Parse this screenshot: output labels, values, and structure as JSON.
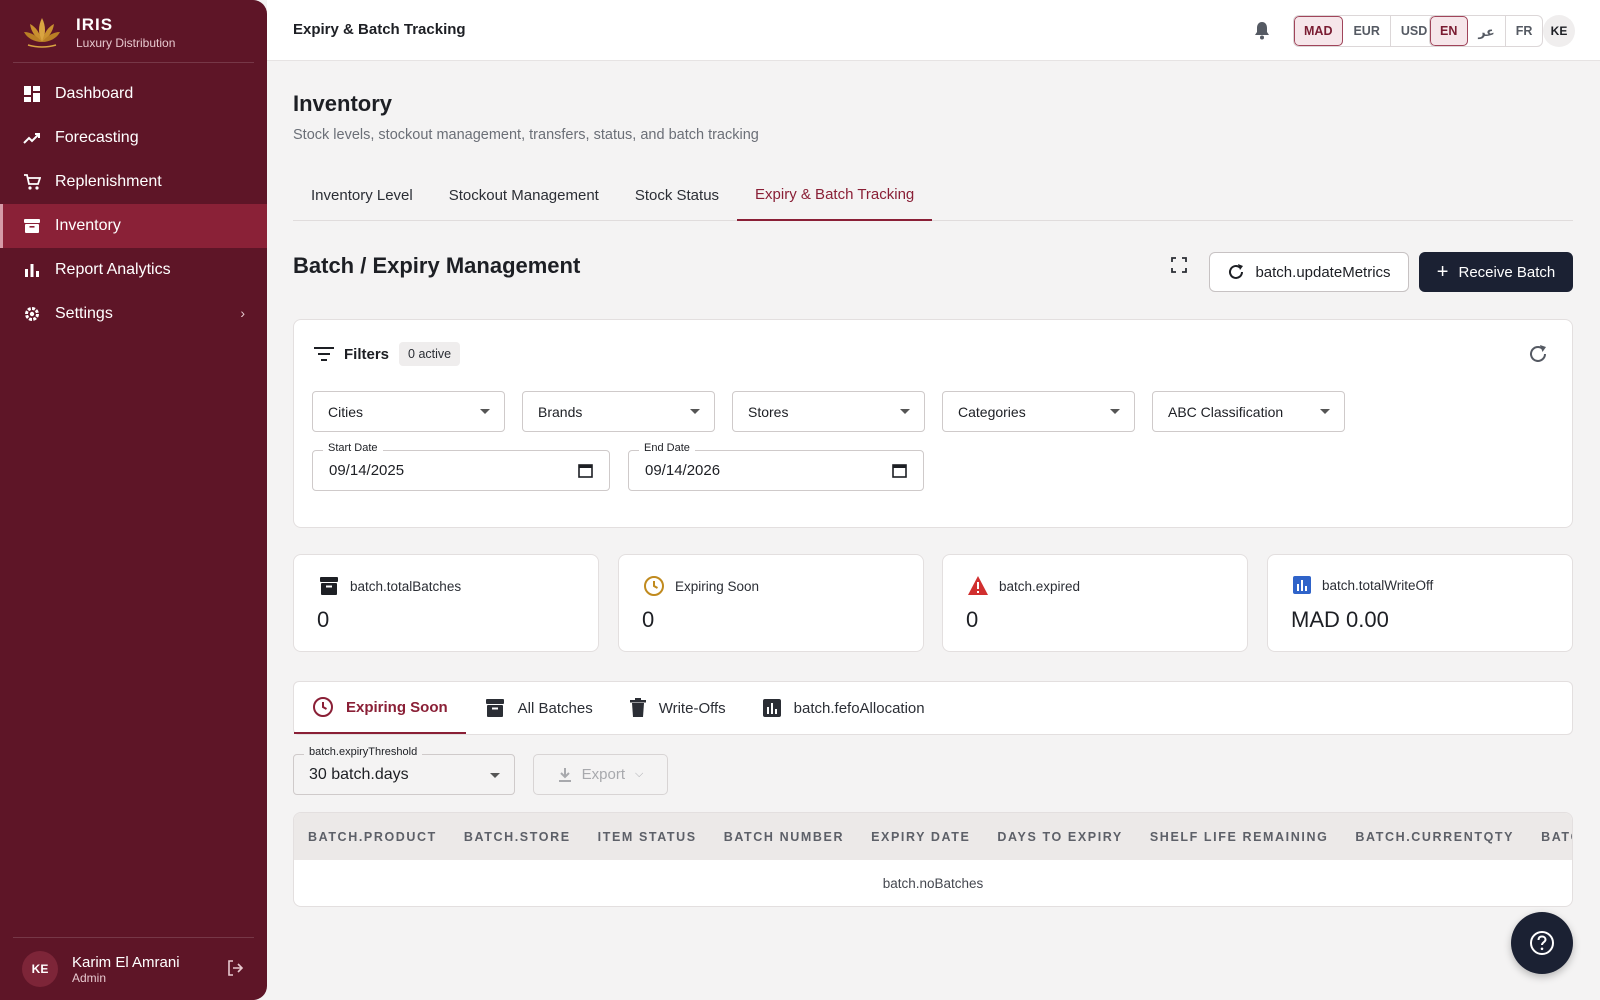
{
  "brand": {
    "name": "IRIS",
    "subtitle": "Luxury Distribution"
  },
  "sidebar": {
    "items": [
      {
        "label": "Dashboard",
        "icon": "dashboard-icon"
      },
      {
        "label": "Forecasting",
        "icon": "trending-up-icon"
      },
      {
        "label": "Replenishment",
        "icon": "cart-icon"
      },
      {
        "label": "Inventory",
        "icon": "archive-icon",
        "active": true
      },
      {
        "label": "Report Analytics",
        "icon": "bar-chart-icon"
      },
      {
        "label": "Settings",
        "icon": "gear-icon"
      }
    ],
    "user": {
      "initials": "KE",
      "name": "Karim El Amrani",
      "role": "Admin"
    }
  },
  "topbar": {
    "title": "Expiry & Batch Tracking",
    "currencies": [
      "MAD",
      "EUR",
      "USD"
    ],
    "selected_currency": "MAD",
    "languages": [
      "EN",
      "عر",
      "FR"
    ],
    "selected_language": "EN",
    "avatar_initials": "KE"
  },
  "page": {
    "title": "Inventory",
    "subtitle": "Stock levels, stockout management, transfers, status, and batch tracking",
    "tabs": [
      "Inventory Level",
      "Stockout Management",
      "Stock Status",
      "Expiry & Batch Tracking"
    ],
    "active_tab": "Expiry & Batch Tracking"
  },
  "section": {
    "title": "Batch / Expiry Management",
    "update_button": "batch.updateMetrics",
    "receive_button": "Receive Batch"
  },
  "filters": {
    "title": "Filters",
    "active_badge": "0 active",
    "selects": [
      "Cities",
      "Brands",
      "Stores",
      "Categories",
      "ABC Classification"
    ],
    "start_date_label": "Start Date",
    "start_date": "09/14/2025",
    "end_date_label": "End Date",
    "end_date": "09/14/2026"
  },
  "kpis": [
    {
      "label": "batch.totalBatches",
      "value": "0",
      "icon": "archive-icon",
      "color": "#1d1f24"
    },
    {
      "label": "Expiring Soon",
      "value": "0",
      "icon": "clock-icon",
      "color": "#c08a1e"
    },
    {
      "label": "batch.expired",
      "value": "0",
      "icon": "warning-icon",
      "color": "#d12f2f"
    },
    {
      "label": "batch.totalWriteOff",
      "value": "MAD 0.00",
      "icon": "bar-chart-icon",
      "color": "#2f63c9"
    }
  ],
  "subtabs": [
    {
      "label": "Expiring Soon",
      "icon": "clock-icon"
    },
    {
      "label": "All Batches",
      "icon": "archive-icon"
    },
    {
      "label": "Write-Offs",
      "icon": "trash-icon"
    },
    {
      "label": "batch.fefoAllocation",
      "icon": "bar-chart-icon"
    }
  ],
  "threshold": {
    "label": "batch.expiryThreshold",
    "value": "30 batch.days"
  },
  "export_label": "Export",
  "table": {
    "columns": [
      "BATCH.PRODUCT",
      "BATCH.STORE",
      "ITEM STATUS",
      "BATCH NUMBER",
      "EXPIRY DATE",
      "DAYS TO EXPIRY",
      "SHELF LIFE REMAINING",
      "BATCH.CURRENTQTY",
      "BATCH.V..."
    ],
    "empty_text": "batch.noBatches"
  },
  "colors": {
    "sidebar": "#5e1527",
    "accent": "#8a1f36",
    "dark_button": "#1b2133"
  }
}
